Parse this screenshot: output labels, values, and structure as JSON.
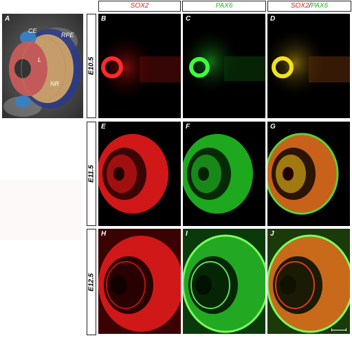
{
  "headers": {
    "col1": "SOX2",
    "col2": "PAX6",
    "col3_a": "SOX2",
    "col3_sep": "/",
    "col3_b": "PAX6"
  },
  "colors": {
    "sox2": "#e21b1b",
    "pax6": "#22b822",
    "background": "#000000"
  },
  "stages": [
    "E10.5",
    "E11.5",
    "E12.5"
  ],
  "panel_labels": [
    "A",
    "B",
    "C",
    "D",
    "E",
    "F",
    "G",
    "H",
    "I",
    "J"
  ],
  "sem_labels": {
    "ce": "CE",
    "rpe": "RPE",
    "l": "L",
    "nr": "NR"
  }
}
